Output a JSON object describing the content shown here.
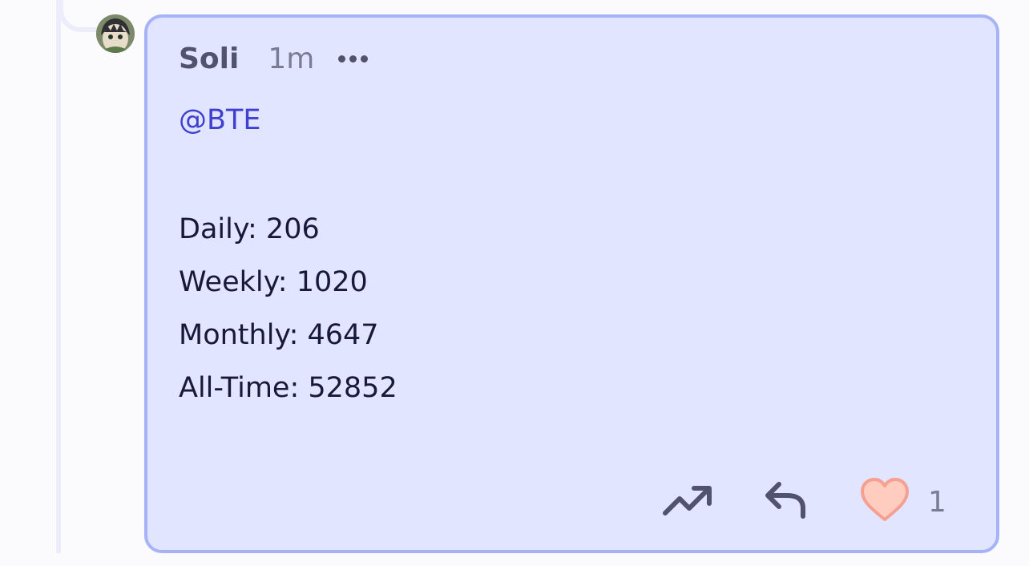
{
  "comment": {
    "author": "Soli",
    "timestamp": "1m",
    "mention": "@BTE",
    "stats": [
      "Daily: 206",
      "Weekly: 1020",
      "Monthly: 4647",
      "All-Time: 52852"
    ],
    "like_count": "1"
  },
  "icons": {
    "more": "more-horizontal-icon",
    "boost": "trending-up-icon",
    "reply": "reply-icon",
    "like": "heart-icon"
  },
  "colors": {
    "card_background": "#e1e5ff",
    "card_border": "#a7b3f7",
    "mention": "#3f3fd0",
    "heart_fill": "#ffcdc0",
    "heart_stroke": "#f5a090"
  }
}
